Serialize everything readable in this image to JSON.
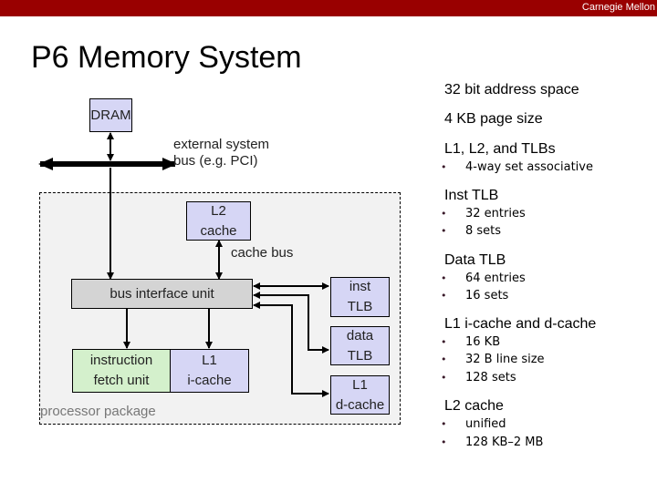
{
  "header": {
    "brand": "Carnegie Mellon",
    "brand_color": "#990000"
  },
  "slide": {
    "title": "P6 Memory System"
  },
  "diagram": {
    "dram": "DRAM",
    "external_bus_label_line1": "external system",
    "external_bus_label_line2": "bus (e.g. PCI)",
    "l2_cache_line1": "L2",
    "l2_cache_line2": "cache",
    "cache_bus_label": "cache bus",
    "bus_interface_unit": "bus interface unit",
    "inst_tlb_line1": "inst",
    "inst_tlb_line2": "TLB",
    "data_tlb_line1": "data",
    "data_tlb_line2": "TLB",
    "l1_dcache_line1": "L1",
    "l1_dcache_line2": "d-cache",
    "ifetch_line1": "instruction",
    "ifetch_line2": "fetch unit",
    "l1_icache_line1": "L1",
    "l1_icache_line2": "i-cache",
    "package_label": "processor package",
    "colors": {
      "memory_box": "#d6d6f5",
      "bus_interface": "#d4d4d4",
      "fetch_unit": "#d4f0cc",
      "package_bg": "#f2f2f2"
    }
  },
  "specs": {
    "address_space": "32 bit address space",
    "page_size": "4 KB page size",
    "sections": [
      {
        "heading": "L1, L2, and TLBs",
        "bullets": [
          "4-way set associative"
        ]
      },
      {
        "heading": "Inst TLB",
        "bullets": [
          "32 entries",
          "8 sets"
        ]
      },
      {
        "heading": "Data TLB",
        "bullets": [
          "64 entries",
          "16 sets"
        ]
      },
      {
        "heading": "L1 i-cache and d-cache",
        "bullets": [
          "16 KB",
          "32 B line size",
          "128 sets"
        ]
      },
      {
        "heading": "L2  cache",
        "bullets": [
          "unified",
          "128 KB–2 MB"
        ]
      }
    ],
    "bullet_glyph": "•"
  }
}
